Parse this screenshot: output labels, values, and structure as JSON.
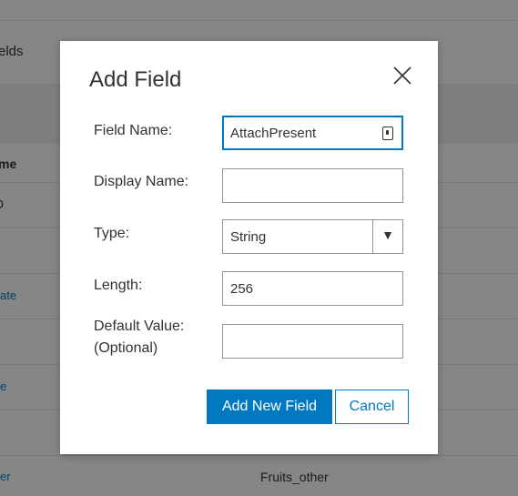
{
  "background": {
    "header_text": "elds",
    "column_header": "me",
    "row_links": [
      "ate",
      "e",
      "er"
    ],
    "row_fragment": "D",
    "last_row_value": "Fruits_other"
  },
  "dialog": {
    "title": "Add Field",
    "close_icon": "close-icon",
    "fields": {
      "field_name": {
        "label": "Field Name:",
        "value": "AttachPresent",
        "icon": "lock-icon"
      },
      "display_name": {
        "label": "Display Name:",
        "value": ""
      },
      "type": {
        "label": "Type:",
        "value": "String",
        "arrow": "▼"
      },
      "length": {
        "label": "Length:",
        "value": "256"
      },
      "default_value": {
        "label_line1": "Default Value:",
        "label_line2": "(Optional)",
        "value": ""
      }
    },
    "buttons": {
      "add": "Add New Field",
      "cancel": "Cancel"
    }
  },
  "colors": {
    "accent": "#0079c1",
    "scrim": "#000000"
  }
}
